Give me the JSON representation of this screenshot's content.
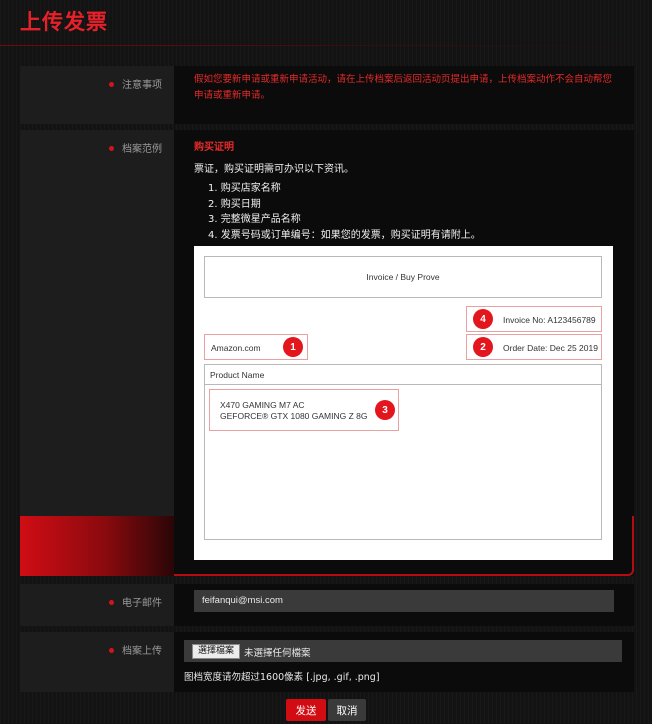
{
  "page": {
    "title": "上传发票"
  },
  "notice": {
    "label": "注意事项",
    "text": "假如您要新申请或重新申请活动，请在上传档案后返回活动页提出申请，上传档案动作不会自动帮您申请或重新申请。"
  },
  "sample": {
    "label": "档案范例",
    "heading": "购买证明",
    "intro": "票证，购买证明需可办识以下资讯。",
    "items": [
      "1. 购买店家名称",
      "2. 购买日期",
      "3. 完整微星产品名称",
      "4. 发票号码或订单编号：如果您的发票，购买证明有请附上。"
    ],
    "invoice": {
      "title": "Invoice / Buy Prove",
      "invoice_no": "Invoice No: A123456789",
      "store": "Amazon.com",
      "order_date": "Order Date: Dec 25 2019",
      "product_header": "Product Name",
      "product_line1": "X470 GAMING M7 AC",
      "product_line2": "GEFORCE® GTX 1080 GAMING Z 8G",
      "badges": [
        "1",
        "2",
        "3",
        "4"
      ]
    }
  },
  "email": {
    "label": "电子邮件",
    "value": "feifanqui@msi.com"
  },
  "upload": {
    "label": "档案上传",
    "button_label": "選擇檔案",
    "status": "未選擇任何檔案",
    "hint": "图档宽度请勿超过1600像素 [.jpg, .gif, .png]"
  },
  "actions": {
    "send_label": "发送",
    "cancel_label": "取消"
  },
  "colors": {
    "accent": "#d10c13",
    "notice_text": "#e42a2a"
  }
}
